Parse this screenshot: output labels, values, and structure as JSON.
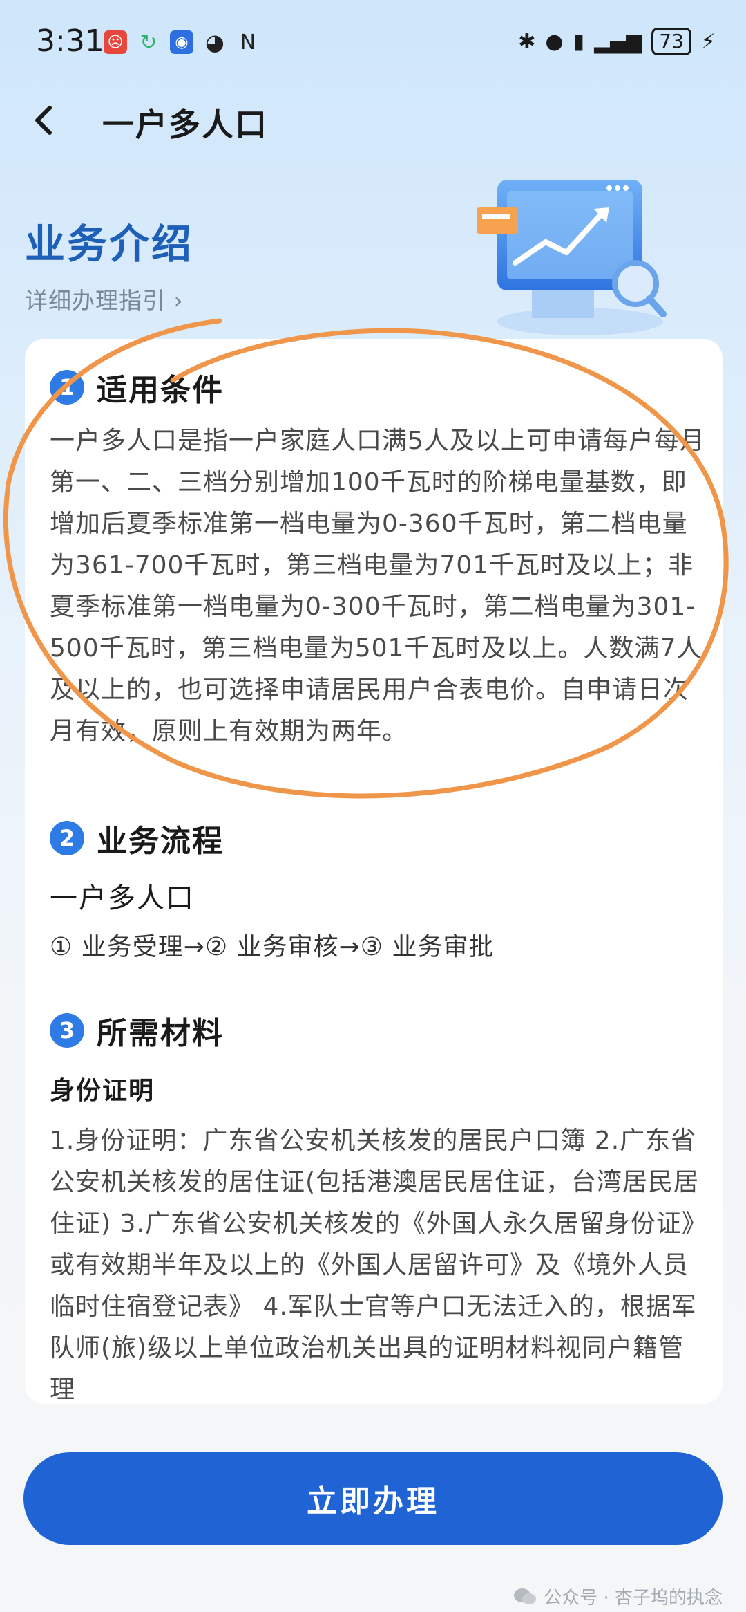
{
  "status_bar": {
    "time": "3:31",
    "battery": "73"
  },
  "nav": {
    "title": "一户多人口"
  },
  "hero": {
    "title": "业务介绍",
    "guide_link": "详细办理指引 ›"
  },
  "sections": [
    {
      "number": "1",
      "title": "适用条件",
      "body": "一户多人口是指一户家庭人口满5人及以上可申请每户每月第一、二、三档分别增加100千瓦时的阶梯电量基数，即增加后夏季标准第一档电量为0-360千瓦时，第二档电量为361-700千瓦时，第三档电量为701千瓦时及以上；非夏季标准第一档电量为0-300千瓦时，第二档电量为301-500千瓦时，第三档电量为501千瓦时及以上。人数满7人及以上的，也可选择申请居民用户合表电价。自申请日次月有效，原则上有效期为两年。"
    },
    {
      "number": "2",
      "title": "业务流程",
      "subtitle": "一户多人口",
      "flow": "① 业务受理→② 业务审核→③ 业务审批"
    },
    {
      "number": "3",
      "title": "所需材料",
      "subtitle": "身份证明",
      "body": "1.身份证明：广东省公安机关核发的居民户口簿 2.广东省公安机关核发的居住证(包括港澳居民居住证，台湾居民居住证) 3.广东省公安机关核发的《外国人永久居留身份证》或有效期半年及以上的《外国人居留许可》及《境外人员临时住宿登记表》 4.军队士官等户口无法迁入的，根据军队师(旅)级以上单位政治机关出具的证明材料视同户籍管理"
    }
  ],
  "actions": {
    "apply_label": "立即办理"
  },
  "watermark": {
    "text": "公众号 · 杏子坞的执念"
  },
  "colors": {
    "accent": "#1f63d4",
    "title_blue": "#1e5fb8",
    "badge_blue": "#2f7be6",
    "annotation_orange": "#f0964a"
  }
}
